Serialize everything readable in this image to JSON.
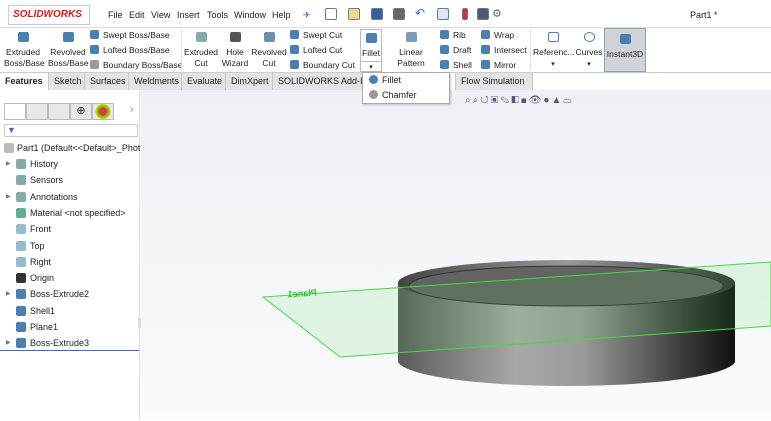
{
  "app": {
    "logo": "SOLIDWORKS",
    "document_title": "Part1 *"
  },
  "menu": [
    "File",
    "Edit",
    "View",
    "Insert",
    "Tools",
    "Window",
    "Help"
  ],
  "ribbon": {
    "extruded_boss": "Extruded Boss/Base",
    "revolved_boss": "Revolved Boss/Base",
    "swept_boss": "Swept Boss/Base",
    "lofted_boss": "Lofted Boss/Base",
    "boundary_boss": "Boundary Boss/Base",
    "extruded_cut": "Extruded Cut",
    "hole_wizard": "Hole Wizard",
    "revolved_cut": "Revolved Cut",
    "swept_cut": "Swept Cut",
    "lofted_cut": "Lofted Cut",
    "boundary_cut": "Boundary Cut",
    "fillet": "Fillet",
    "linear_pattern": "Linear Pattern",
    "rib": "Rib",
    "draft": "Draft",
    "shell": "Shell",
    "wrap": "Wrap",
    "intersect": "Intersect",
    "mirror": "Mirror",
    "reference": "Referenc...",
    "curves": "Curves",
    "instant3d": "Instant3D"
  },
  "tabs": [
    "Features",
    "Sketch",
    "Surfaces",
    "Weldments",
    "Evaluate",
    "DimXpert",
    "SOLIDWORKS Add-In",
    "Flow Simulation"
  ],
  "active_tab": "Features",
  "fillet_dropdown": [
    "Fillet",
    "Chamfer"
  ],
  "tree": {
    "root": "Part1  (Default<<Default>_Phot",
    "items": [
      {
        "label": "History",
        "icon": "history-folder-icon",
        "expandable": true
      },
      {
        "label": "Sensors",
        "icon": "sensors-folder-icon",
        "expandable": false
      },
      {
        "label": "Annotations",
        "icon": "annotations-folder-icon",
        "expandable": true
      },
      {
        "label": "Material <not specified>",
        "icon": "material-icon",
        "expandable": false
      },
      {
        "label": "Front",
        "icon": "plane-icon",
        "expandable": false
      },
      {
        "label": "Top",
        "icon": "plane-icon",
        "expandable": false
      },
      {
        "label": "Right",
        "icon": "plane-icon",
        "expandable": false
      },
      {
        "label": "Origin",
        "icon": "origin-icon",
        "expandable": false
      },
      {
        "label": "Boss-Extrude2",
        "icon": "extrude-icon",
        "expandable": true
      },
      {
        "label": "Shell1",
        "icon": "shell-icon",
        "expandable": false
      },
      {
        "label": "Plane1",
        "icon": "plane-feature-icon",
        "expandable": false
      },
      {
        "label": "Boss-Extrude3",
        "icon": "extrude-icon",
        "expandable": true
      }
    ]
  },
  "viewport": {
    "plane_label": "Plane1",
    "plane_color": "#3fdc3f",
    "model_color": "#8a8a8a"
  }
}
